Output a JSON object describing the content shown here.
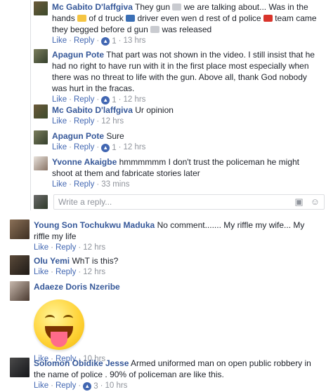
{
  "comments": [
    {
      "name": "Mc Gabito D'laffgiva",
      "segments": [
        "They gun",
        "we are talking about... Was in the hands",
        "of d truck",
        "driver even wen d rest of d police",
        "team came they begged before d gun",
        "was released"
      ],
      "like": "Like",
      "reply": "Reply",
      "likes": "1",
      "time": "13 hrs"
    },
    {
      "name": "Apagun Pote",
      "text": "That part was not shown in the video. I still insist that he had no right to have run with it in the first place most especially when there was no threat to life with the gun. Above all, thank God nobody was hurt in the fracas.",
      "like": "Like",
      "reply": "Reply",
      "likes": "1",
      "time": "12 hrs"
    },
    {
      "name": "Mc Gabito D'laffgiva",
      "text": "Ur opinion",
      "like": "Like",
      "reply": "Reply",
      "time": "12 hrs"
    },
    {
      "name": "Apagun Pote",
      "text": "Sure",
      "like": "Like",
      "reply": "Reply",
      "likes": "1",
      "time": "12 hrs"
    },
    {
      "name": "Yvonne Akaigbe",
      "text": "hmmmmmm I don't trust the policeman he might shoot at them and fabricate stories later",
      "like": "Like",
      "reply": "Reply",
      "time": "33 mins"
    },
    {
      "name": "Young Son Tochukwu Maduka",
      "text": "No comment....... My riffle my wife... My riffle my life",
      "like": "Like",
      "reply": "Reply",
      "time": "12 hrs"
    },
    {
      "name": "Olu Yemi",
      "text": "WhT is this?",
      "like": "Like",
      "reply": "Reply",
      "time": "12 hrs"
    },
    {
      "name": "Adaeze Doris Nzeribe",
      "like": "Like",
      "reply": "Reply",
      "time": "10 hrs"
    },
    {
      "name": "Solomon Obidike Jesse",
      "text": "Armed uniformed man on open public robbery in the name of police . 90% of policeman are like this.",
      "like": "Like",
      "reply": "Reply",
      "likes": "3",
      "time": "10 hrs"
    }
  ],
  "reply_box": {
    "placeholder": "Write a reply..."
  },
  "icons": {
    "like": "thumbs-up-icon",
    "camera": "camera-icon",
    "emoji": "smiley-icon"
  },
  "colors": {
    "name": "#365899",
    "link": "#4267b2",
    "meta": "#90949c",
    "like_badge": "#4267b2"
  }
}
